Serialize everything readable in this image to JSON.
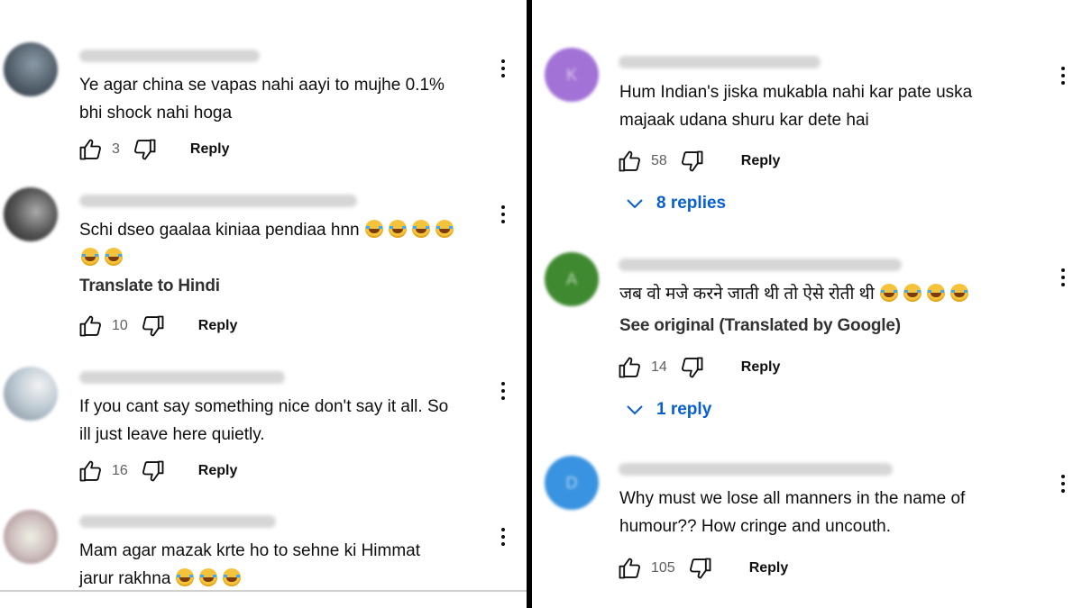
{
  "left": {
    "comments": [
      {
        "text_lines": [
          "Ye agar china se vapas nahi aayi to mujhe 0.1%",
          "bhi shock nahi hoga"
        ],
        "emoji_count": 0,
        "likes": "3",
        "reply_label": "Reply"
      },
      {
        "text_lines": [
          "Schi dseo gaalaa kiniaa pendiaa hnn"
        ],
        "emoji_lines": [
          4,
          2
        ],
        "translate": "Translate to Hindi",
        "likes": "10",
        "reply_label": "Reply"
      },
      {
        "text_lines": [
          "If you cant say something nice don't say it all. So",
          "ill just leave here quietly."
        ],
        "likes": "16",
        "reply_label": "Reply"
      },
      {
        "text_lines": [
          "Mam agar mazak krte ho to sehne ki Himmat",
          "jarur rakhna"
        ],
        "emoji_count": 3
      }
    ]
  },
  "right": {
    "comments": [
      {
        "avatar_letter": "K",
        "avatar_color": "#a272d6",
        "text_lines": [
          "Hum Indian's jiska mukabla nahi kar pate uska",
          "majaak udana shuru kar dete hai"
        ],
        "likes": "58",
        "reply_label": "Reply",
        "replies": "8 replies"
      },
      {
        "avatar_letter": "A",
        "avatar_color": "#3f8a30",
        "text_lines": [
          "जब वो मजे करने जाती थी तो ऐसे रोती थी"
        ],
        "emoji_count": 4,
        "translate": "See original (Translated by Google)",
        "likes": "14",
        "reply_label": "Reply",
        "replies": "1 reply"
      },
      {
        "avatar_letter": "D",
        "avatar_color": "#3a93e0",
        "text_lines": [
          "Why must we lose all manners in the name of",
          "humour?? How cringe and uncouth."
        ],
        "likes": "105",
        "reply_label": "Reply"
      }
    ]
  },
  "colors": {
    "link": "#065fd4",
    "text": "#0f0f0f",
    "divider": "#000000"
  }
}
